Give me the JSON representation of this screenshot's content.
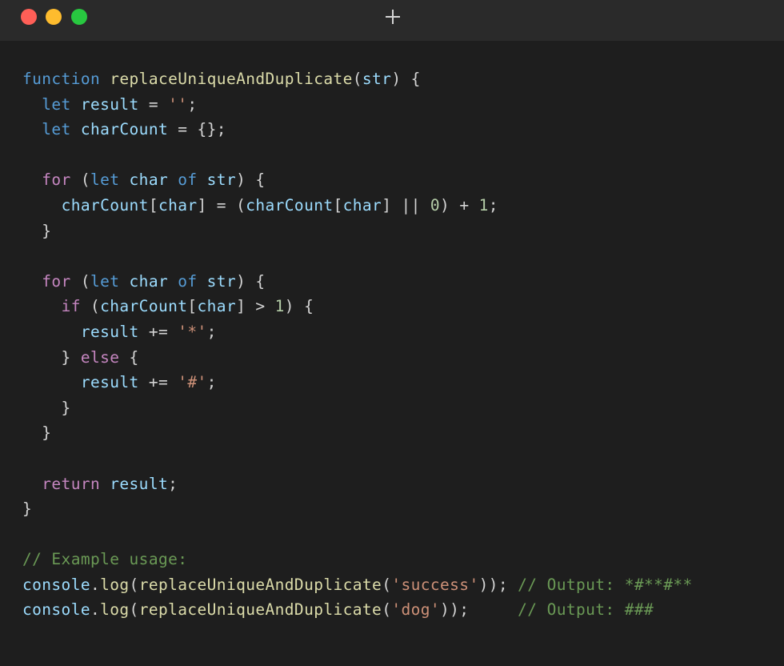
{
  "window": {
    "close_color": "#ff5f57",
    "minimize_color": "#febc2e",
    "maximize_color": "#28c840",
    "new_tab_icon": "plus-icon"
  },
  "code": {
    "lines": [
      [
        [
          "kw",
          "function"
        ],
        [
          "pun",
          " "
        ],
        [
          "fn",
          "replaceUniqueAndDuplicate"
        ],
        [
          "pun",
          "("
        ],
        [
          "var",
          "str"
        ],
        [
          "pun",
          ") {"
        ]
      ],
      [
        [
          "pun",
          "  "
        ],
        [
          "kw",
          "let"
        ],
        [
          "pun",
          " "
        ],
        [
          "var",
          "result"
        ],
        [
          "pun",
          " = "
        ],
        [
          "str",
          "''"
        ],
        [
          "pun",
          ";"
        ]
      ],
      [
        [
          "pun",
          "  "
        ],
        [
          "kw",
          "let"
        ],
        [
          "pun",
          " "
        ],
        [
          "var",
          "charCount"
        ],
        [
          "pun",
          " = {};"
        ]
      ],
      [],
      [
        [
          "pun",
          "  "
        ],
        [
          "ctl",
          "for"
        ],
        [
          "pun",
          " ("
        ],
        [
          "kw",
          "let"
        ],
        [
          "pun",
          " "
        ],
        [
          "var",
          "char"
        ],
        [
          "pun",
          " "
        ],
        [
          "kw",
          "of"
        ],
        [
          "pun",
          " "
        ],
        [
          "var",
          "str"
        ],
        [
          "pun",
          ") {"
        ]
      ],
      [
        [
          "pun",
          "    "
        ],
        [
          "var",
          "charCount"
        ],
        [
          "pun",
          "["
        ],
        [
          "var",
          "char"
        ],
        [
          "pun",
          "] = ("
        ],
        [
          "var",
          "charCount"
        ],
        [
          "pun",
          "["
        ],
        [
          "var",
          "char"
        ],
        [
          "pun",
          "] || "
        ],
        [
          "num",
          "0"
        ],
        [
          "pun",
          ") + "
        ],
        [
          "num",
          "1"
        ],
        [
          "pun",
          ";"
        ]
      ],
      [
        [
          "pun",
          "  }"
        ]
      ],
      [],
      [
        [
          "pun",
          "  "
        ],
        [
          "ctl",
          "for"
        ],
        [
          "pun",
          " ("
        ],
        [
          "kw",
          "let"
        ],
        [
          "pun",
          " "
        ],
        [
          "var",
          "char"
        ],
        [
          "pun",
          " "
        ],
        [
          "kw",
          "of"
        ],
        [
          "pun",
          " "
        ],
        [
          "var",
          "str"
        ],
        [
          "pun",
          ") {"
        ]
      ],
      [
        [
          "pun",
          "    "
        ],
        [
          "ctl",
          "if"
        ],
        [
          "pun",
          " ("
        ],
        [
          "var",
          "charCount"
        ],
        [
          "pun",
          "["
        ],
        [
          "var",
          "char"
        ],
        [
          "pun",
          "] > "
        ],
        [
          "num",
          "1"
        ],
        [
          "pun",
          ") {"
        ]
      ],
      [
        [
          "pun",
          "      "
        ],
        [
          "var",
          "result"
        ],
        [
          "pun",
          " += "
        ],
        [
          "str",
          "'*'"
        ],
        [
          "pun",
          ";"
        ]
      ],
      [
        [
          "pun",
          "    } "
        ],
        [
          "ctl",
          "else"
        ],
        [
          "pun",
          " {"
        ]
      ],
      [
        [
          "pun",
          "      "
        ],
        [
          "var",
          "result"
        ],
        [
          "pun",
          " += "
        ],
        [
          "str",
          "'#'"
        ],
        [
          "pun",
          ";"
        ]
      ],
      [
        [
          "pun",
          "    }"
        ]
      ],
      [
        [
          "pun",
          "  }"
        ]
      ],
      [],
      [
        [
          "pun",
          "  "
        ],
        [
          "ctl",
          "return"
        ],
        [
          "pun",
          " "
        ],
        [
          "var",
          "result"
        ],
        [
          "pun",
          ";"
        ]
      ],
      [
        [
          "pun",
          "}"
        ]
      ],
      [],
      [
        [
          "com",
          "// Example usage:"
        ]
      ],
      [
        [
          "var",
          "console"
        ],
        [
          "pun",
          "."
        ],
        [
          "fn",
          "log"
        ],
        [
          "pun",
          "("
        ],
        [
          "fn",
          "replaceUniqueAndDuplicate"
        ],
        [
          "pun",
          "("
        ],
        [
          "str",
          "'success'"
        ],
        [
          "pun",
          "));"
        ],
        [
          "pun",
          " "
        ],
        [
          "com",
          "// Output: *#**#**"
        ]
      ],
      [
        [
          "var",
          "console"
        ],
        [
          "pun",
          "."
        ],
        [
          "fn",
          "log"
        ],
        [
          "pun",
          "("
        ],
        [
          "fn",
          "replaceUniqueAndDuplicate"
        ],
        [
          "pun",
          "("
        ],
        [
          "str",
          "'dog'"
        ],
        [
          "pun",
          "));"
        ],
        [
          "pun",
          "     "
        ],
        [
          "com",
          "// Output: ###"
        ]
      ]
    ]
  }
}
